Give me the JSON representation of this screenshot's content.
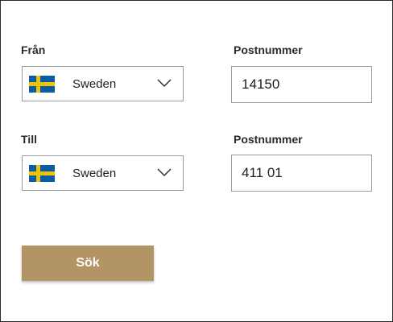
{
  "from": {
    "label": "Från",
    "country": "Sweden",
    "postal_label": "Postnummer",
    "postal_value": "14150"
  },
  "to": {
    "label": "Till",
    "country": "Sweden",
    "postal_label": "Postnummer",
    "postal_value": "411 01"
  },
  "search_button": "Sök",
  "colors": {
    "button": "#b39465",
    "flag_blue": "#0a5ca6",
    "flag_yellow": "#f2c400",
    "border": "#9a9a9a"
  },
  "icons": {
    "flag": "sweden-flag-icon",
    "dropdown": "chevron-down-icon"
  }
}
